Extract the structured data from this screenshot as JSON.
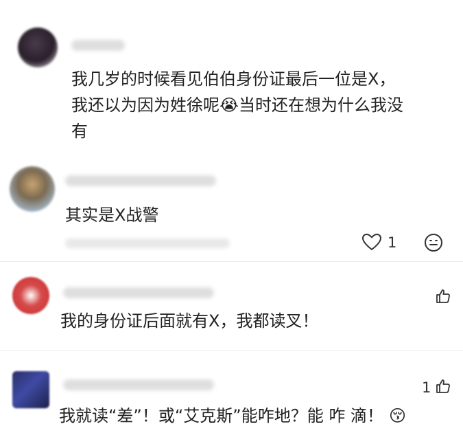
{
  "comments": [
    {
      "lines": [
        "我几岁的时候看见伯伯身份证最后一位是X，",
        "我还以为因为姓徐呢",
        "当时还在想为什么我没",
        "有"
      ],
      "emoji": "😭"
    },
    {
      "text": "其实是X战警",
      "like_count": "1"
    },
    {
      "text": "我的身份证后面就有X，我都读叉！"
    },
    {
      "text": "我就读“差”！或“艾克斯”能咋地？能  咋  滴！",
      "emoji": "😚",
      "like_count": "1"
    }
  ]
}
